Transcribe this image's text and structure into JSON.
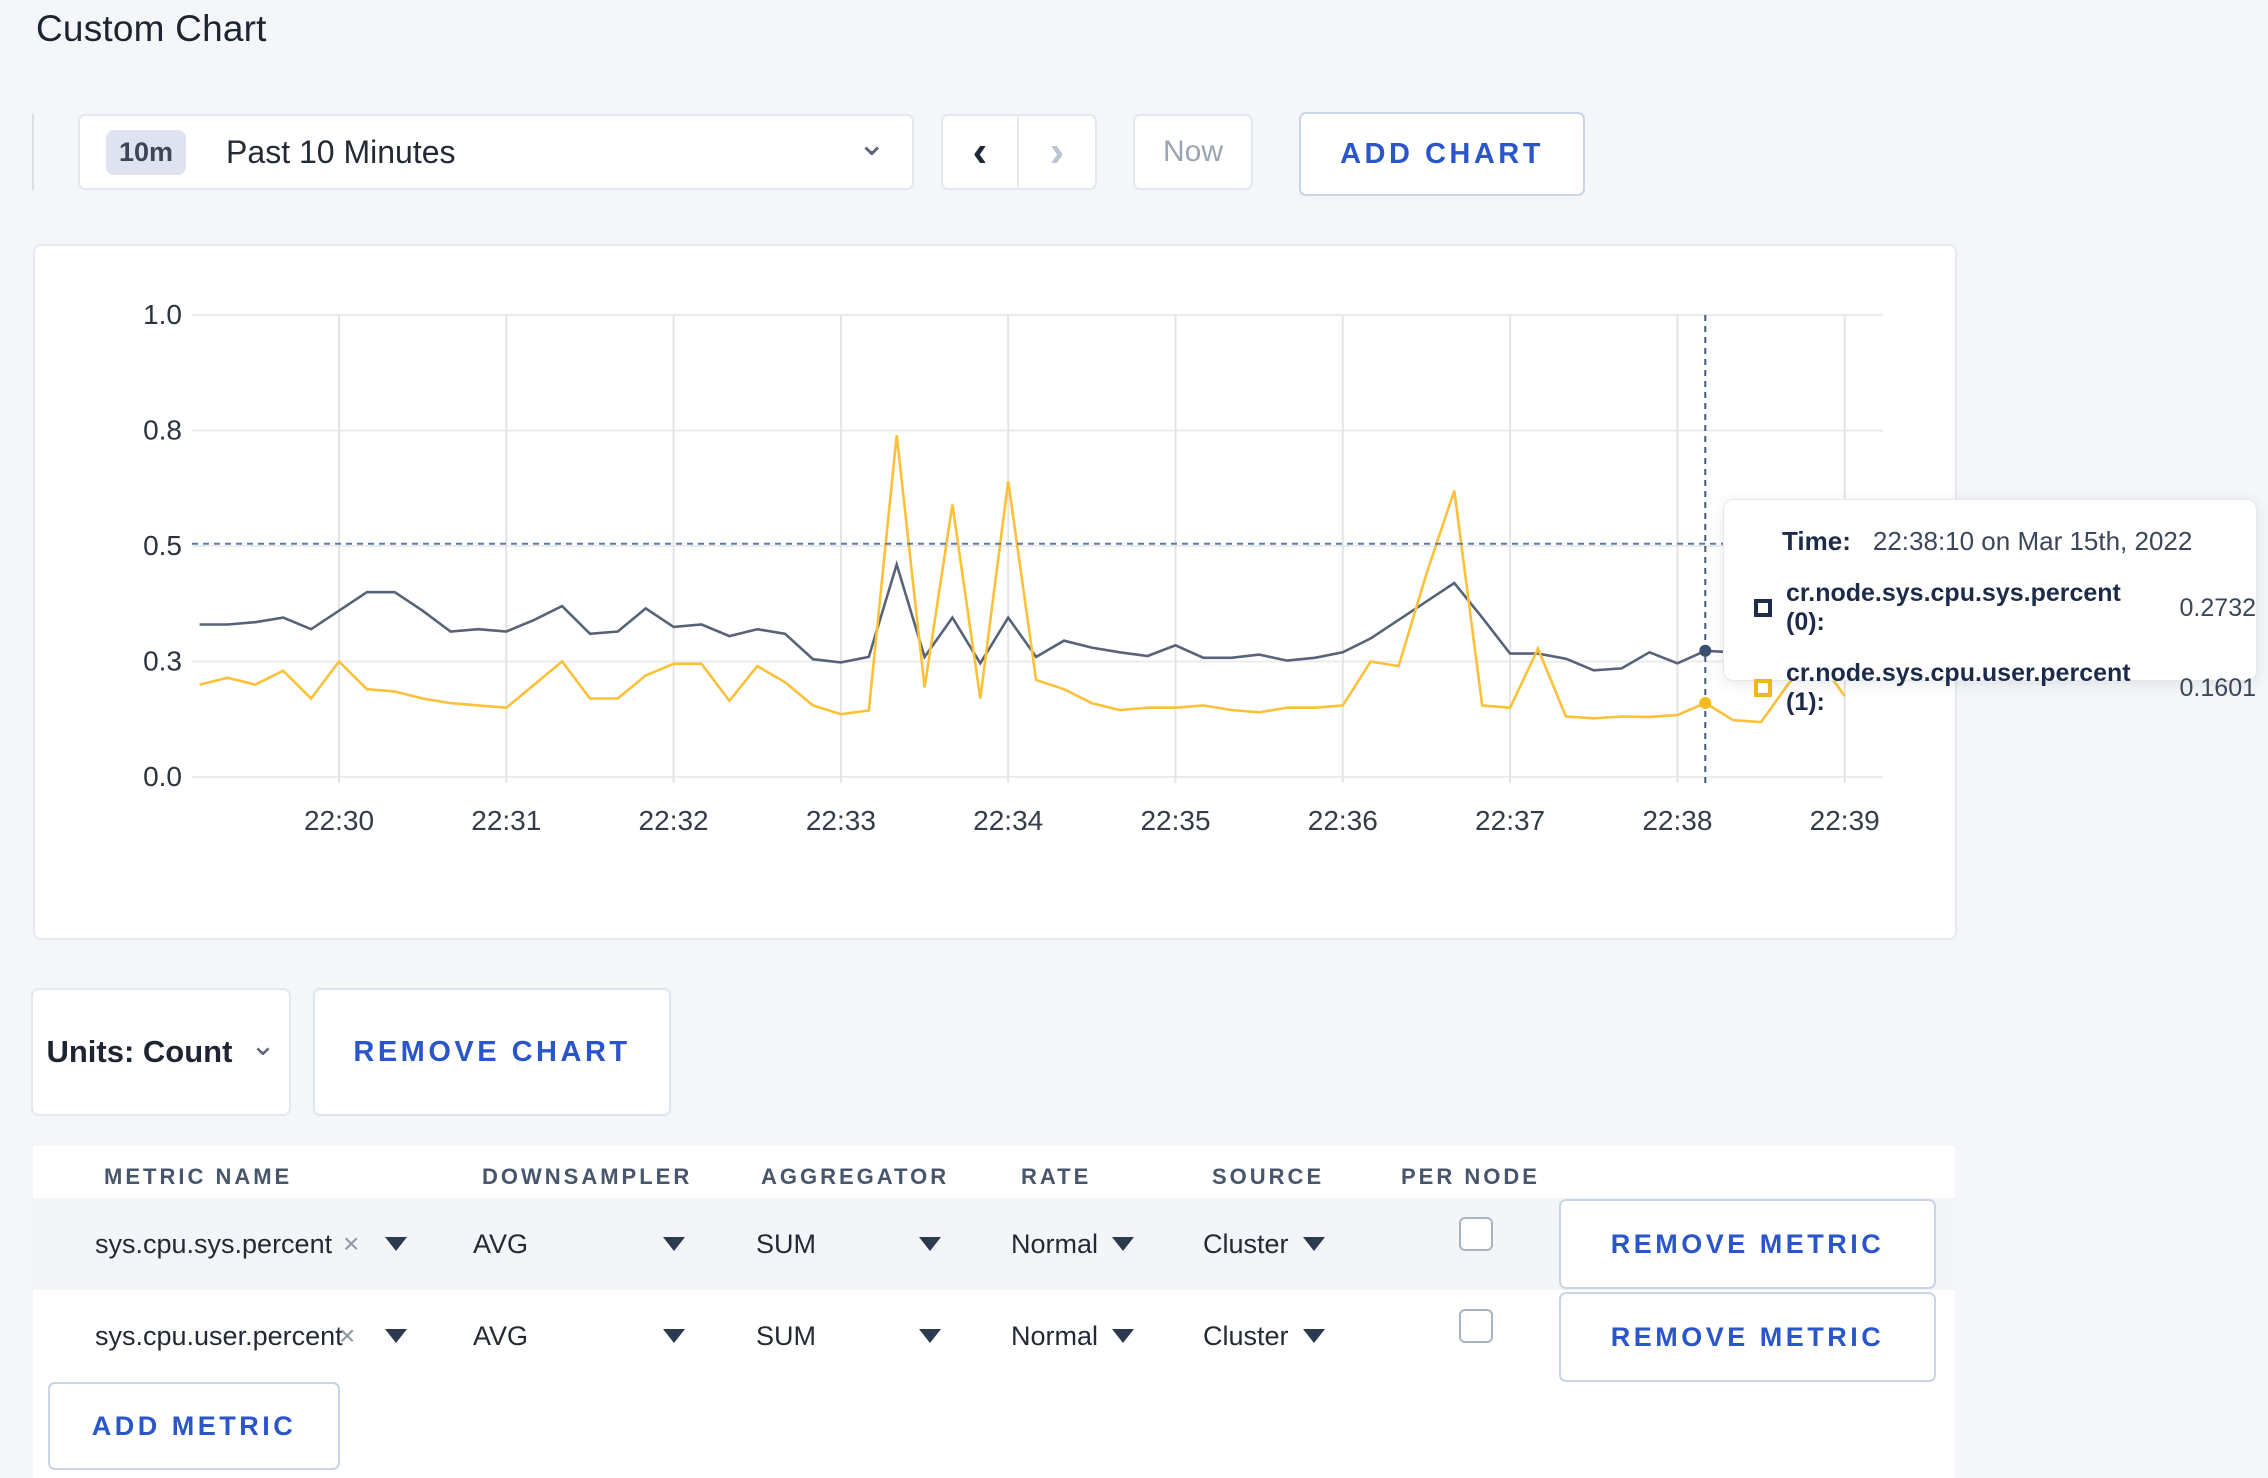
{
  "page": {
    "title": "Custom Chart",
    "accent": "#2a56c9",
    "background": "#f4f6f9"
  },
  "toolbar": {
    "range_badge": "10m",
    "range_label": "Past 10 Minutes",
    "dropdown_caret": "⌄",
    "prev_icon": "‹",
    "next_icon": "›",
    "now_label": "Now",
    "add_chart_label": "ADD CHART"
  },
  "chart_data": {
    "type": "line",
    "title": "",
    "xlabel": "",
    "ylabel": "",
    "ylim": [
      0,
      1
    ],
    "grid": true,
    "legend_position": "tooltip",
    "x_minute_ticks": [
      "22:30",
      "22:31",
      "22:32",
      "22:33",
      "22:34",
      "22:35",
      "22:36",
      "22:37",
      "22:38",
      "22:39"
    ],
    "y_ticks": [
      {
        "label": "0.0",
        "value": 0
      },
      {
        "label": "0.3",
        "value": 0.25
      },
      {
        "label": "0.5",
        "value": 0.5
      },
      {
        "label": "0.8",
        "value": 0.75
      },
      {
        "label": "1.0",
        "value": 1.0
      }
    ],
    "start_time": "22:29:10",
    "interval_seconds": 10,
    "start_offset_seconds": -50,
    "series": [
      {
        "name": "cr.node.sys.cpu.sys.percent",
        "color": "#566379",
        "values": [
          0.33,
          0.33,
          0.335,
          0.345,
          0.32,
          0.36,
          0.4,
          0.4,
          0.36,
          0.315,
          0.32,
          0.315,
          0.34,
          0.37,
          0.31,
          0.315,
          0.365,
          0.325,
          0.33,
          0.305,
          0.32,
          0.31,
          0.255,
          0.248,
          0.26,
          0.46,
          0.26,
          0.345,
          0.246,
          0.345,
          0.26,
          0.295,
          0.28,
          0.27,
          0.262,
          0.285,
          0.258,
          0.258,
          0.265,
          0.252,
          0.258,
          0.27,
          0.3,
          0.34,
          0.38,
          0.42,
          0.345,
          0.267,
          0.267,
          0.256,
          0.231,
          0.235,
          0.27,
          0.246,
          0.2732,
          0.27,
          0.285,
          0.295,
          0.29,
          0.295
        ]
      },
      {
        "name": "cr.node.sys.cpu.user.percent",
        "color": "#fbc139",
        "values": [
          0.2,
          0.215,
          0.2,
          0.23,
          0.17,
          0.25,
          0.19,
          0.185,
          0.17,
          0.16,
          0.155,
          0.15,
          0.2,
          0.25,
          0.17,
          0.17,
          0.22,
          0.245,
          0.245,
          0.165,
          0.24,
          0.205,
          0.155,
          0.136,
          0.144,
          0.74,
          0.194,
          0.59,
          0.17,
          0.64,
          0.21,
          0.19,
          0.16,
          0.145,
          0.15,
          0.15,
          0.155,
          0.145,
          0.14,
          0.15,
          0.15,
          0.155,
          0.25,
          0.24,
          0.44,
          0.62,
          0.155,
          0.15,
          0.278,
          0.131,
          0.127,
          0.131,
          0.13,
          0.134,
          0.1601,
          0.123,
          0.119,
          0.203,
          0.26,
          0.175
        ]
      }
    ],
    "crosshair": {
      "time_index": 54,
      "h_value": 0.505
    }
  },
  "tooltip": {
    "time_label": "Time:",
    "time_value": "22:38:10 on Mar 15th, 2022",
    "rows": [
      {
        "label": "cr.node.sys.cpu.sys.percent (0):",
        "value": "0.2732",
        "color": "#1f2d4d"
      },
      {
        "label": "cr.node.sys.cpu.user.percent (1):",
        "value": "0.1601",
        "color": "#f0b61c"
      }
    ]
  },
  "chart_footer": {
    "units_label": "Units: Count",
    "units_caret": "⌄",
    "remove_chart_label": "REMOVE CHART"
  },
  "table": {
    "headers": [
      "METRIC NAME",
      "DOWNSAMPLER",
      "AGGREGATOR",
      "RATE",
      "SOURCE",
      "PER NODE"
    ],
    "close_icon": "×",
    "rows": [
      {
        "metric": "sys.cpu.sys.percent",
        "downsampler": "AVG",
        "aggregator": "SUM",
        "rate": "Normal",
        "source": "Cluster",
        "per_node_checked": false,
        "remove_label": "REMOVE METRIC"
      },
      {
        "metric": "sys.cpu.user.percent",
        "downsampler": "AVG",
        "aggregator": "SUM",
        "rate": "Normal",
        "source": "Cluster",
        "per_node_checked": false,
        "remove_label": "REMOVE METRIC"
      }
    ],
    "add_metric_label": "ADD METRIC"
  }
}
